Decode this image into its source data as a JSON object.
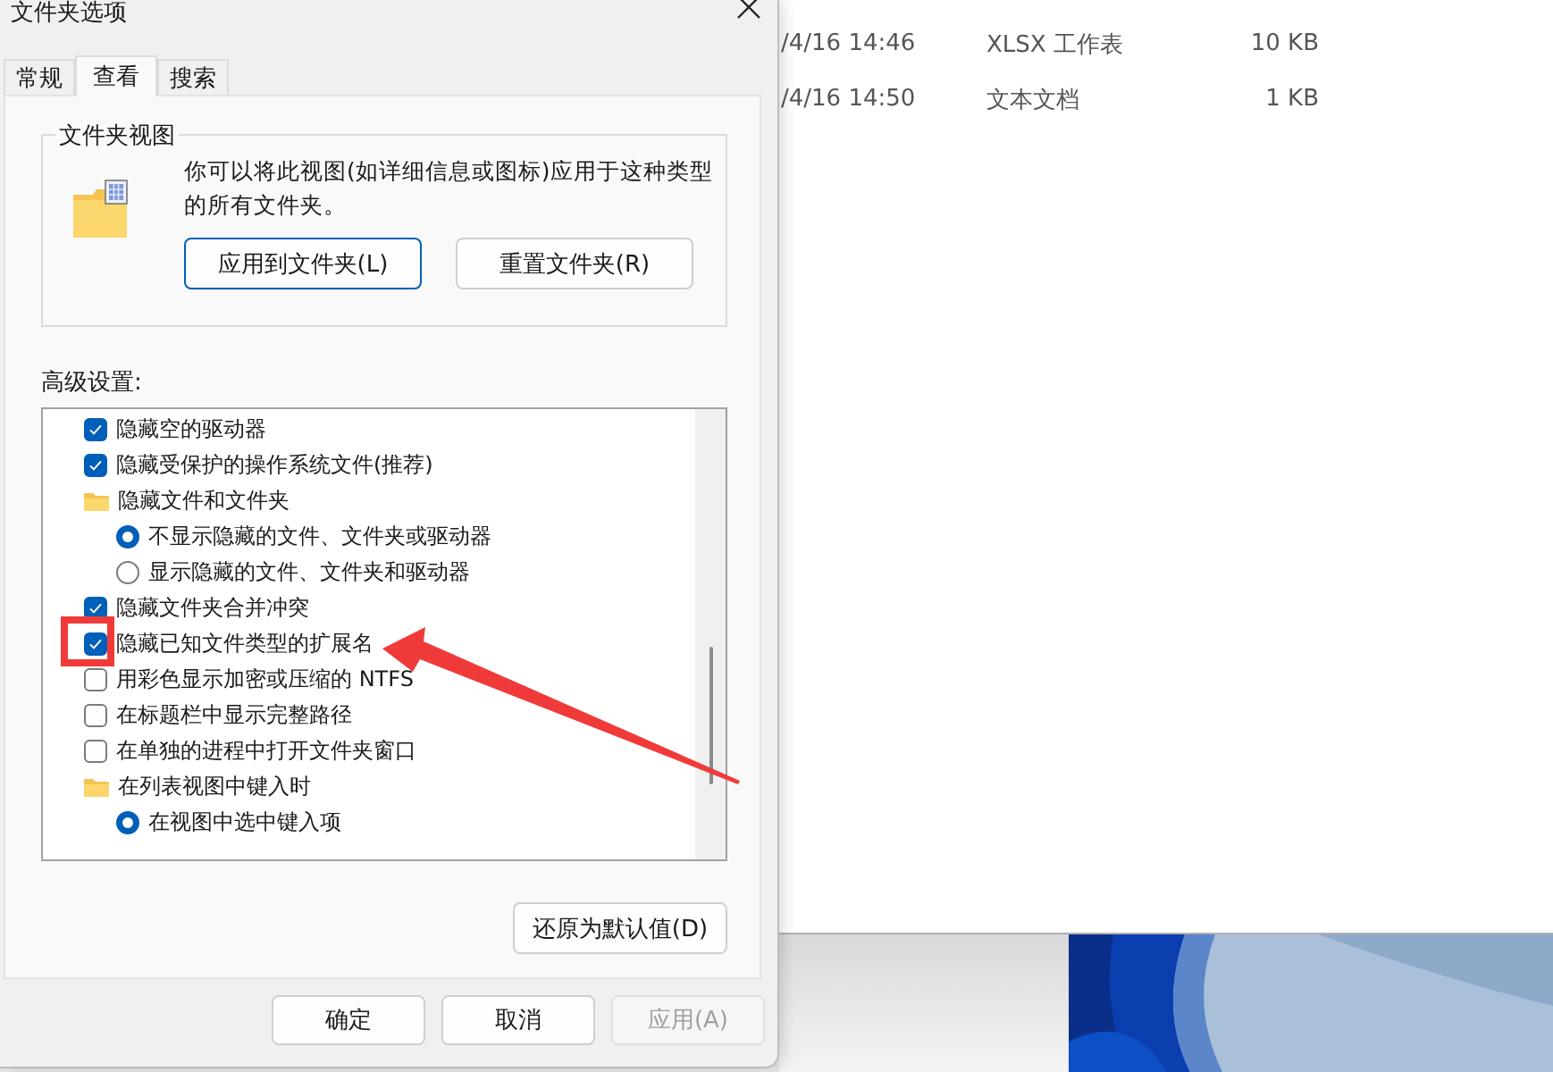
{
  "window": {
    "title": "文件夹选项"
  },
  "tabs": [
    {
      "label": "常规",
      "selected": false
    },
    {
      "label": "查看",
      "selected": true
    },
    {
      "label": "搜索",
      "selected": false
    }
  ],
  "folder_views": {
    "title": "文件夹视图",
    "description": "你可以将此视图(如详细信息或图标)应用于这种类型的所有文件夹。",
    "buttons": [
      {
        "label": "应用到文件夹(L)",
        "focused": true
      },
      {
        "label": "重置文件夹(R)",
        "focused": false
      }
    ]
  },
  "advanced": {
    "label": "高级设置:",
    "items": [
      {
        "kind": "checkbox",
        "label": "隐藏空的驱动器",
        "checked": true
      },
      {
        "kind": "checkbox",
        "label": "隐藏受保护的操作系统文件(推荐)",
        "checked": true
      },
      {
        "kind": "folder",
        "label": "隐藏文件和文件夹",
        "children": [
          {
            "kind": "radio",
            "label": "不显示隐藏的文件、文件夹或驱动器",
            "selected": true
          },
          {
            "kind": "radio",
            "label": "显示隐藏的文件、文件夹和驱动器",
            "selected": false
          }
        ]
      },
      {
        "kind": "checkbox",
        "label": "隐藏文件夹合并冲突",
        "checked": true
      },
      {
        "kind": "checkbox",
        "label": "隐藏已知文件类型的扩展名",
        "checked": true
      },
      {
        "kind": "checkbox",
        "label": "用彩色显示加密或压缩的 NTFS",
        "checked": false
      },
      {
        "kind": "checkbox",
        "label": "在标题栏中显示完整路径",
        "checked": false
      },
      {
        "kind": "checkbox",
        "label": "在单独的进程中打开文件夹窗口",
        "checked": false
      },
      {
        "kind": "folder",
        "label": "在列表视图中键入时",
        "children": [
          {
            "kind": "radio",
            "label": "在视图中选中键入项",
            "selected": true
          }
        ]
      }
    ]
  },
  "restore_button": "还原为默认值(D)",
  "buttons": [
    {
      "label": "确定",
      "disabled": false
    },
    {
      "label": "取消",
      "disabled": false
    },
    {
      "label": "应用(A)",
      "disabled": true
    }
  ],
  "explorer": {
    "rows": [
      {
        "date": "/4/16 14:46",
        "type": "XLSX 工作表",
        "size": "10 KB"
      },
      {
        "date": "/4/16 14:50",
        "type": "文本文档",
        "size": "1 KB"
      }
    ]
  }
}
